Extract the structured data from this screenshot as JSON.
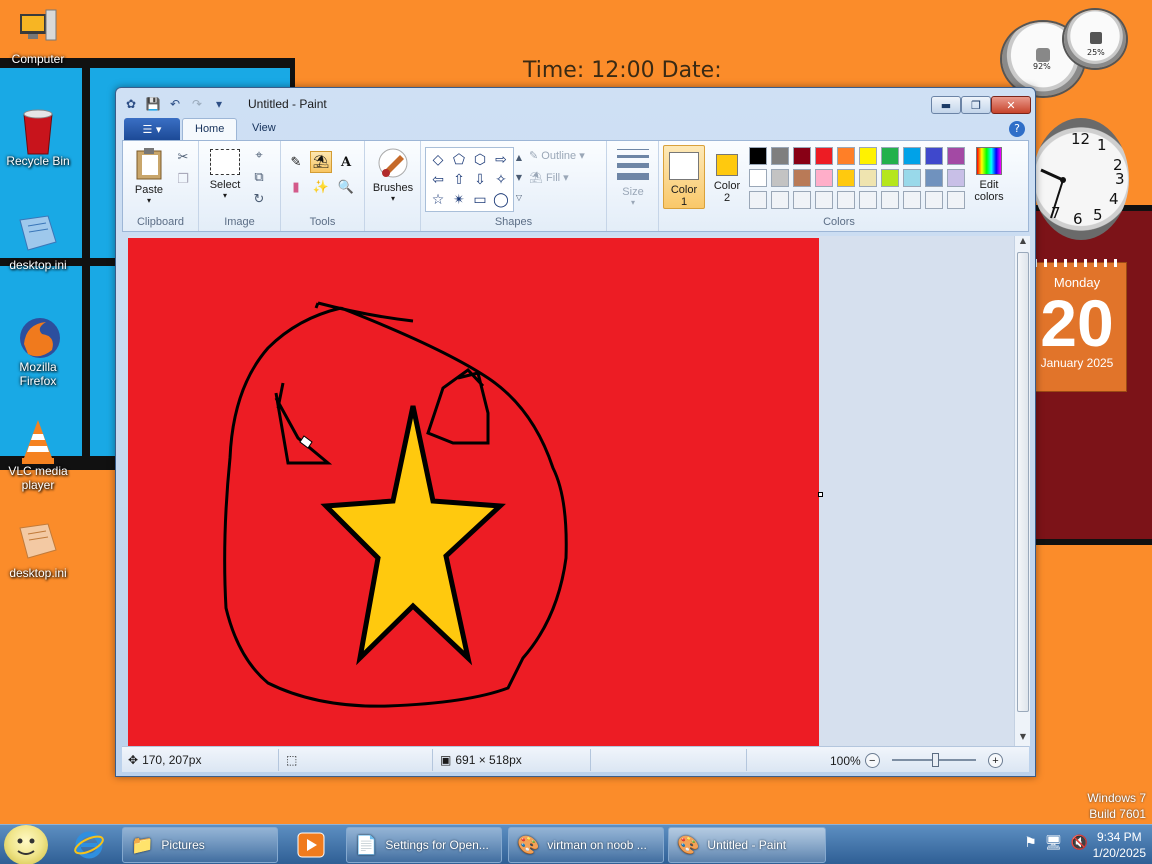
{
  "desktop": {
    "banner": "Time: 12:00 Date:",
    "icons": [
      {
        "label": "Computer"
      },
      {
        "label": "Recycle Bin"
      },
      {
        "label": "desktop.ini"
      },
      {
        "label": "Mozilla Firefox"
      },
      {
        "label": "VLC media player"
      },
      {
        "label": "desktop.ini"
      }
    ],
    "gadgets": {
      "cpu_percent": "92%",
      "mem_percent": "25%",
      "clock_numbers": [
        "12",
        "1",
        "2",
        "3",
        "4",
        "5",
        "6",
        "7"
      ],
      "calendar": {
        "weekday": "Monday",
        "day": "20",
        "month_year": "January 2025"
      }
    },
    "watermark": {
      "line1": "Windows 7",
      "line2": "Build 7601"
    }
  },
  "paint": {
    "window_title": "Untitled - Paint",
    "tabs": {
      "file": "☰ ▾",
      "home": "Home",
      "view": "View"
    },
    "ribbon": {
      "clipboard": {
        "paste": "Paste",
        "group": "Clipboard"
      },
      "image": {
        "select": "Select",
        "group": "Image"
      },
      "tools": {
        "group": "Tools",
        "text_tool": "A"
      },
      "brushes": {
        "label": "Brushes"
      },
      "shapes": {
        "group": "Shapes",
        "outline": "Outline",
        "fill": "Fill"
      },
      "size": {
        "label": "Size"
      },
      "colors": {
        "group": "Colors",
        "color1_label": "Color",
        "color1_num": "1",
        "color2_label": "Color",
        "color2_num": "2",
        "edit_colors": "Edit colors",
        "color1": "#FFFFFF",
        "color2": "#FFC90E",
        "palette": [
          "#000000",
          "#7F7F7F",
          "#880015",
          "#ED1C24",
          "#FF7F27",
          "#FFF200",
          "#22B14C",
          "#00A2E8",
          "#3F48CC",
          "#A349A4",
          "#FFFFFF",
          "#C3C3C3",
          "#B97A57",
          "#FFAEC9",
          "#FFC90E",
          "#EFE4B0",
          "#B5E61D",
          "#99D9EA",
          "#7092BE",
          "#C8BFE7",
          "#F0F3F7",
          "#F0F3F7",
          "#F0F3F7",
          "#F0F3F7",
          "#F0F3F7",
          "#F0F3F7",
          "#F0F3F7",
          "#F0F3F7",
          "#F0F3F7",
          "#F0F3F7"
        ]
      }
    },
    "canvas": {
      "background": "#ED1C24",
      "star_fill": "#FFC90E"
    },
    "status": {
      "cursor_pos": "170, 207px",
      "canvas_size": "691 × 518px",
      "zoom": "100%"
    }
  },
  "taskbar": {
    "buttons": [
      {
        "label": "Pictures"
      },
      {
        "label": "Settings for Open..."
      },
      {
        "label": "virtman on noob ..."
      },
      {
        "label": "Untitled - Paint"
      }
    ],
    "time": "9:34 PM",
    "date": "1/20/2025"
  }
}
